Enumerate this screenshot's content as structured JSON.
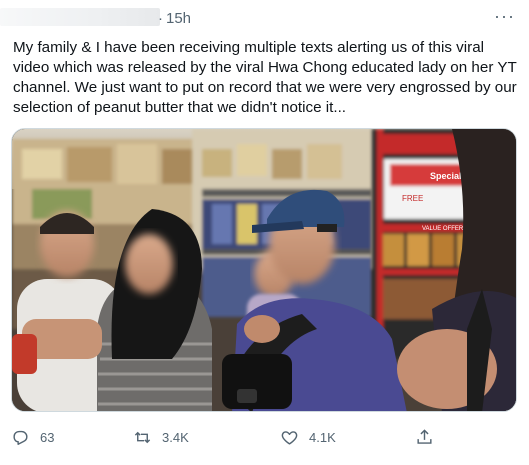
{
  "tweet": {
    "separator": "·",
    "time": "15h",
    "more_label": "···",
    "text": "My family & I have been receiving multiple texts alerting us of this viral video which was released by the viral Hwa Chong educated lady on her YT channel. We just want to put on record that we were very engrossed by our selection of peanut butter that we didn't notice it..."
  },
  "media": {
    "store_sign_label": "Special",
    "store_sign_sub": "FREE",
    "shelf_tag": "VALUE OFFERS"
  },
  "actions": {
    "reply_count": "63",
    "retweet_count": "3.4K",
    "like_count": "4.1K"
  },
  "icons": {
    "reply": "reply-icon",
    "retweet": "retweet-icon",
    "like": "heart-icon",
    "share": "share-icon",
    "more": "more-icon"
  },
  "colors": {
    "text_primary": "#0f1419",
    "text_secondary": "#536471",
    "border": "#cfd9de"
  }
}
